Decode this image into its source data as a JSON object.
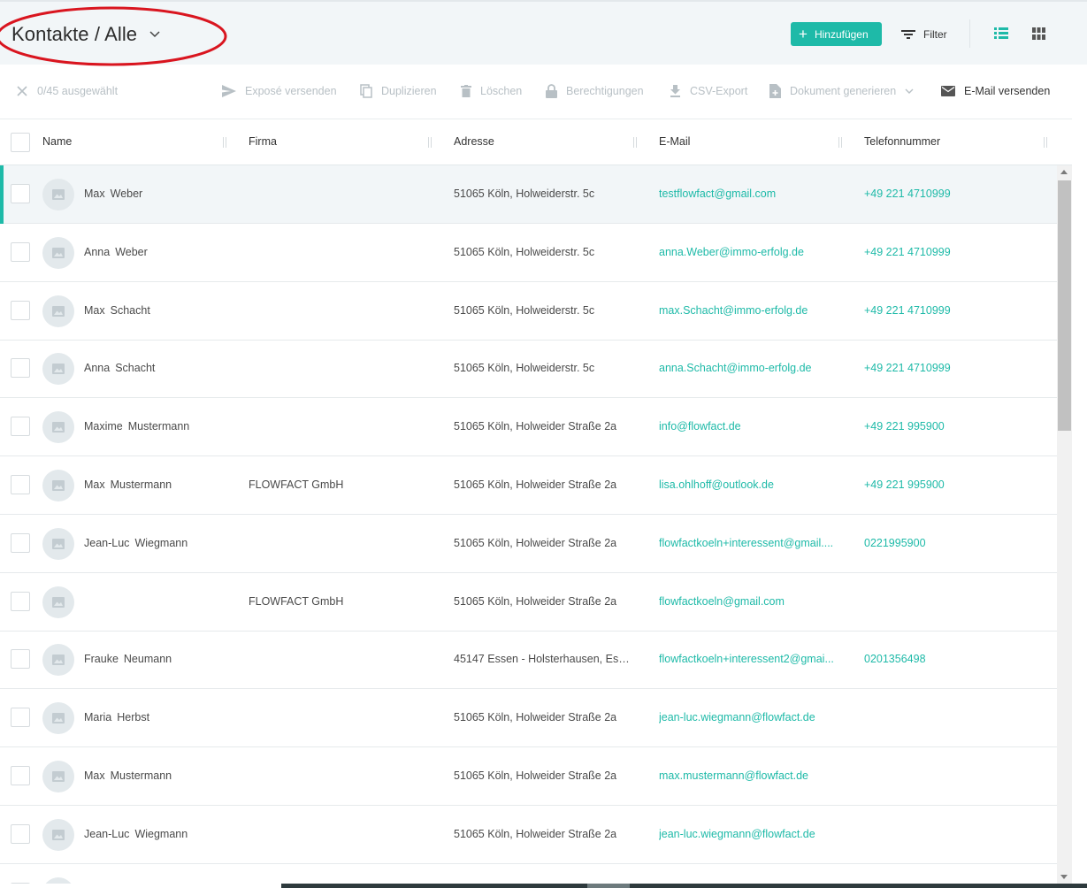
{
  "header": {
    "title": "Kontakte / Alle",
    "add_label": "Hinzufügen",
    "filter_label": "Filter"
  },
  "actions": {
    "selection": "0/45 ausgewählt",
    "expose": "Exposé versenden",
    "duplicate": "Duplizieren",
    "delete": "Löschen",
    "permissions": "Berechtigungen",
    "csv": "CSV-Export",
    "document": "Dokument generieren",
    "email": "E-Mail versenden"
  },
  "columns": {
    "name": "Name",
    "firma": "Firma",
    "adresse": "Adresse",
    "email": "E-Mail",
    "telefon": "Telefonnummer"
  },
  "rows": [
    {
      "first": "Max",
      "last": "Weber",
      "firma": "",
      "adresse": "51065 Köln, Holweiderstr. 5c",
      "email": "testflowfact@gmail.com",
      "telefon": "+49 221 4710999"
    },
    {
      "first": "Anna",
      "last": "Weber",
      "firma": "",
      "adresse": "51065 Köln, Holweiderstr. 5c",
      "email": "anna.Weber@immo-erfolg.de",
      "telefon": "+49 221 4710999"
    },
    {
      "first": "Max",
      "last": "Schacht",
      "firma": "",
      "adresse": "51065 Köln, Holweiderstr. 5c",
      "email": "max.Schacht@immo-erfolg.de",
      "telefon": "+49 221 4710999"
    },
    {
      "first": "Anna",
      "last": "Schacht",
      "firma": "",
      "adresse": "51065 Köln, Holweiderstr. 5c",
      "email": "anna.Schacht@immo-erfolg.de",
      "telefon": "+49 221 4710999"
    },
    {
      "first": "Maxime",
      "last": "Mustermann",
      "firma": "",
      "adresse": "51065 Köln, Holweider Straße 2a",
      "email": "info@flowfact.de",
      "telefon": "+49 221 995900"
    },
    {
      "first": "Max",
      "last": "Mustermann",
      "firma": "FLOWFACT GmbH",
      "adresse": "51065 Köln, Holweider Straße 2a",
      "email": "lisa.ohlhoff@outlook.de",
      "telefon": "+49 221 995900"
    },
    {
      "first": "Jean-Luc",
      "last": "Wiegmann",
      "firma": "",
      "adresse": "51065 Köln, Holweider Straße 2a",
      "email": "flowfactkoeln+interessent@gmail....",
      "telefon": "0221995900"
    },
    {
      "first": "",
      "last": "",
      "firma": "FLOWFACT GmbH",
      "adresse": "51065 Köln, Holweider Straße 2a",
      "email": "flowfactkoeln@gmail.com",
      "telefon": ""
    },
    {
      "first": "Frauke",
      "last": "Neumann",
      "firma": "",
      "adresse": "45147 Essen - Holsterhausen, Ess...",
      "email": "flowfactkoeln+interessent2@gmai...",
      "telefon": "0201356498"
    },
    {
      "first": "Maria",
      "last": "Herbst",
      "firma": "",
      "adresse": "51065 Köln, Holweider Straße 2a",
      "email": "jean-luc.wiegmann@flowfact.de",
      "telefon": ""
    },
    {
      "first": "Max",
      "last": "Mustermann",
      "firma": "",
      "adresse": "51065 Köln, Holweider Straße 2a",
      "email": "max.mustermann@flowfact.de",
      "telefon": ""
    },
    {
      "first": "Jean-Luc",
      "last": "Wiegmann",
      "firma": "",
      "adresse": "51065 Köln, Holweider Straße 2a",
      "email": "jean-luc.wiegmann@flowfact.de",
      "telefon": ""
    },
    {
      "first": "",
      "last": "",
      "firma": "",
      "adresse": "",
      "email": "",
      "telefon": ""
    }
  ],
  "colors": {
    "accent": "#1ebaa8",
    "annotation": "#d9151f"
  }
}
